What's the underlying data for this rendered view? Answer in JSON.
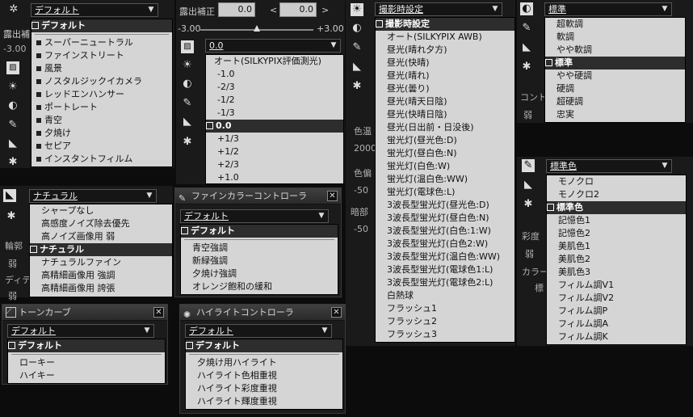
{
  "style_panel": {
    "dropdown": "デフォルト",
    "items": [
      "デフォルト",
      "スーパーニュートラル",
      "ファインストリート",
      "風景",
      "ノスタルジックイカメラ",
      "レッドエンハンサー",
      "ポートレート",
      "青空",
      "夕焼け",
      "セピア",
      "インスタントフィルム"
    ],
    "side_label1": "露出補",
    "side_label2": "-3.00"
  },
  "exposure": {
    "label": "露出補正",
    "value": "0.0",
    "value2": "0.0",
    "min": "-3.00",
    "max": "+3.00",
    "dropdown": "0.0",
    "items": [
      "オート(SILKYPIX評価測光)",
      "-1.0",
      "-2/3",
      "-1/2",
      "-1/3",
      "0.0",
      "+1/3",
      "+1/2",
      "+2/3",
      "+1.0"
    ]
  },
  "wb": {
    "dropdown": "撮影時設定",
    "items": [
      "撮影時設定",
      "オート(SILKYPIX AWB)",
      "昼光(晴れ夕方)",
      "昼光(快晴)",
      "昼光(晴れ)",
      "昼光(曇り)",
      "昼光(晴天日陰)",
      "昼光(快晴日陰)",
      "昼光(日出前・日没後)",
      "蛍光灯(昼光色:D)",
      "蛍光灯(昼白色:N)",
      "蛍光灯(白色:W)",
      "蛍光灯(温白色:WW)",
      "蛍光灯(電球色:L)",
      "3波長型蛍光灯(昼光色:D)",
      "3波長型蛍光灯(昼白色:N)",
      "3波長型蛍光灯(白色:1:W)",
      "3波長型蛍光灯(白色2:W)",
      "3波長型蛍光灯(温白色:WW)",
      "3波長型蛍光灯(電球色1:L)",
      "3波長型蛍光灯(電球色2:L)",
      "白熱球",
      "フラッシュ1",
      "フラッシュ2",
      "フラッシュ3"
    ],
    "side": [
      "色温",
      "2000",
      "色偏",
      "-50",
      "暗部",
      "-50"
    ]
  },
  "contrast": {
    "dropdown": "標準",
    "items": [
      "超軟調",
      "軟調",
      "やや軟調",
      "標準",
      "やや硬調",
      "硬調",
      "超硬調",
      "忠実"
    ],
    "side": [
      "コント",
      "弱"
    ]
  },
  "color": {
    "dropdown": "標準色",
    "items": [
      "モノクロ",
      "モノクロ2",
      "標準色",
      "記憶色1",
      "記憶色2",
      "美肌色1",
      "美肌色2",
      "美肌色3",
      "フィルム調V1",
      "フィルム調V2",
      "フィルム調P",
      "フィルム調A",
      "フィルム調K"
    ],
    "side": [
      "彩度",
      "弱",
      "カラー",
      "標"
    ]
  },
  "sharp": {
    "dropdown": "ナチュラル",
    "items": [
      "シャープなし",
      "高感度ノイズ除去優先",
      "高ノイズ画像用 弱",
      "ナチュラル",
      "ナチュラルファイン",
      "高精細画像用 強調",
      "高精細画像用 誇張"
    ],
    "side": [
      "輪郭",
      "弱",
      "ディテ",
      "弱"
    ]
  },
  "fine_color": {
    "title": "ファインカラーコントローラ",
    "dropdown": "デフォルト",
    "items": [
      "デフォルト",
      "青空強調",
      "新緑強調",
      "夕焼け強調",
      "オレンジ飽和の緩和"
    ]
  },
  "tone": {
    "title": "トーンカーブ",
    "dropdown": "デフォルト",
    "items": [
      "デフォルト",
      "ローキー",
      "ハイキー"
    ]
  },
  "highlight": {
    "title": "ハイライトコントローラ",
    "dropdown": "デフォルト",
    "items": [
      "デフォルト",
      "夕焼け用ハイライト",
      "ハイライト色相重視",
      "ハイライト彩度重視",
      "ハイライト輝度重視"
    ]
  }
}
